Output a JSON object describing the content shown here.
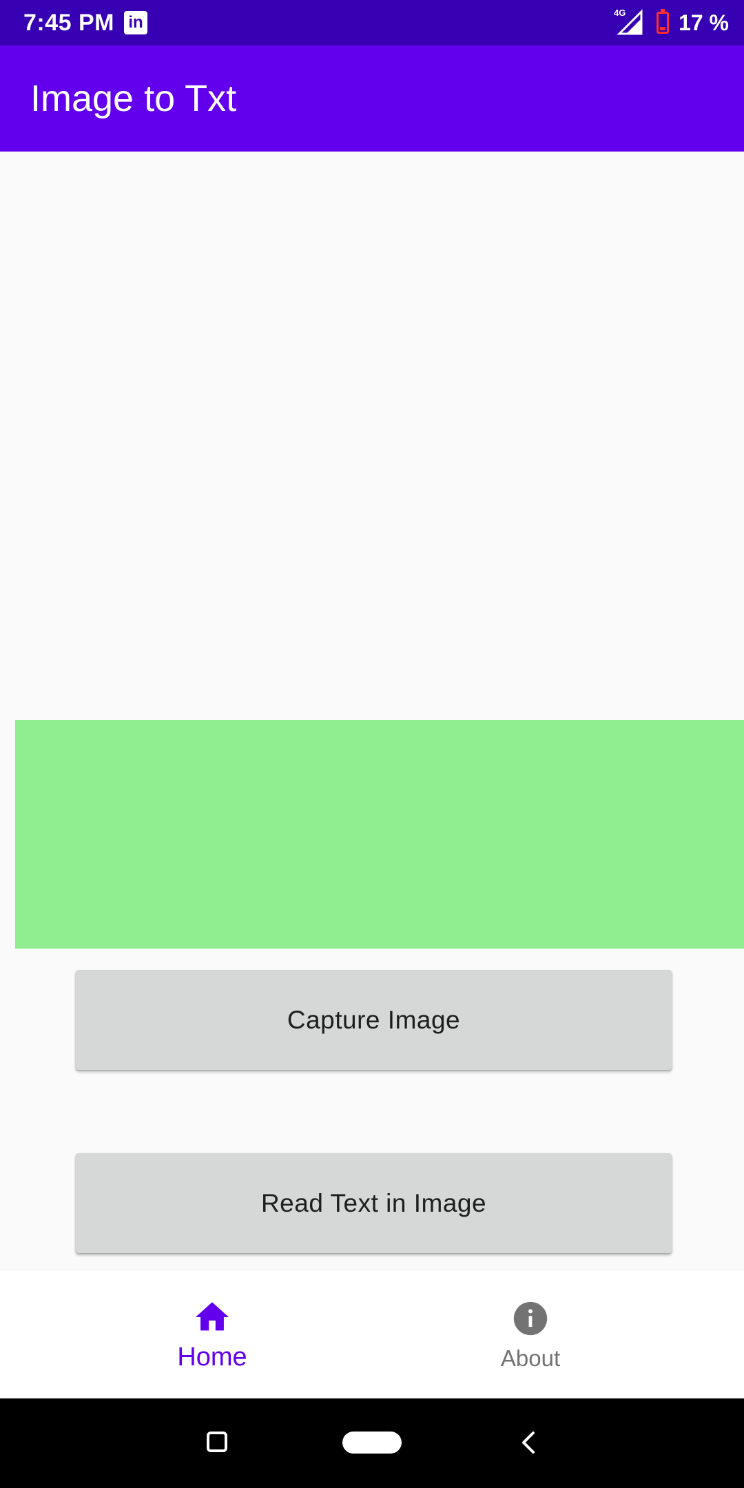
{
  "status_bar": {
    "time": "7:45 PM",
    "notification_icon": "linkedin-icon",
    "linkedin_glyph": "in",
    "network": "4G",
    "battery_percent": "17 %",
    "battery_level": 0.17
  },
  "app_bar": {
    "title": "Image to Txt",
    "color": "#6200EE"
  },
  "image_view": {
    "color": "#90EE90"
  },
  "buttons": {
    "capture": "Capture Image",
    "read_text": "Read Text in Image"
  },
  "bottom_nav": {
    "items": [
      {
        "label": "Home",
        "icon": "home-icon",
        "selected": true
      },
      {
        "label": "About",
        "icon": "info-icon",
        "selected": false
      }
    ],
    "active_color": "#6200EE",
    "inactive_color": "#737373"
  },
  "system_nav": {
    "recents_icon": "recents-icon",
    "home_icon": "home-pill-icon",
    "back_icon": "back-icon"
  }
}
